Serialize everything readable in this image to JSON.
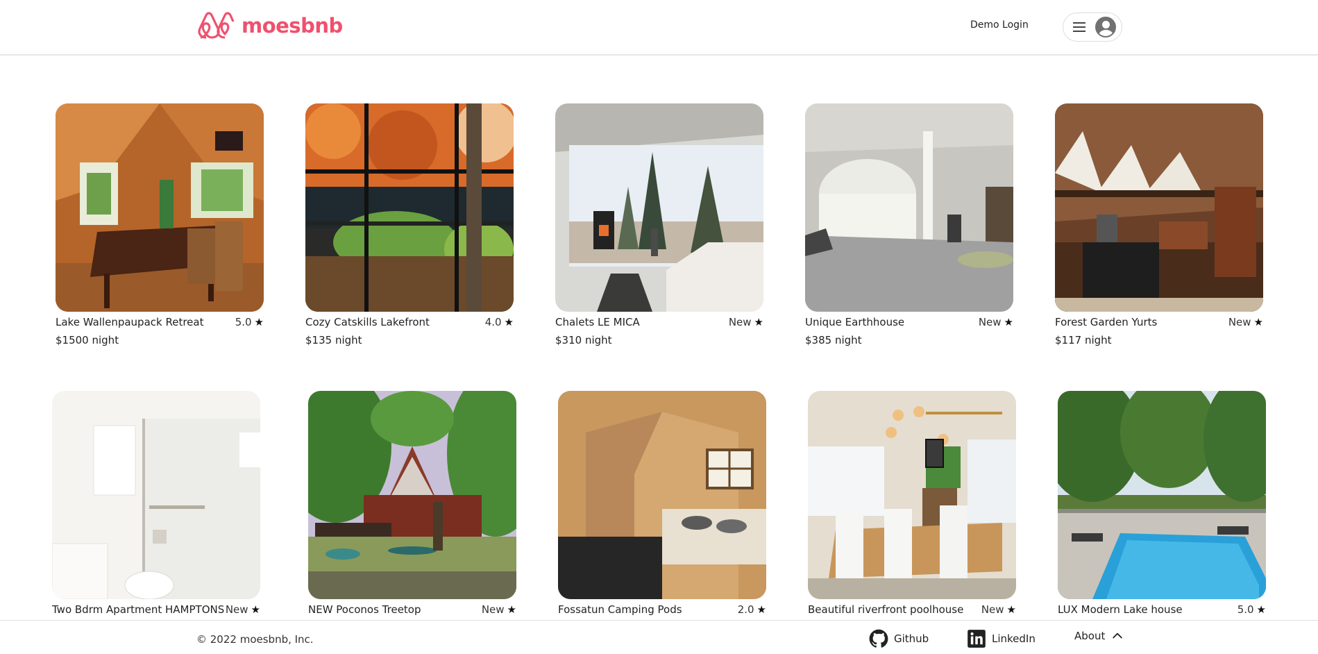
{
  "brand": {
    "name": "moesbnb",
    "color": "#f0506e"
  },
  "header": {
    "demo_login": "Demo Login",
    "menu_icon": "hamburger-icon",
    "avatar_icon": "user-avatar-icon"
  },
  "listings": [
    {
      "title": "Lake Wallenpaupack Retreat",
      "rating": "5.0",
      "price": "$1500 night"
    },
    {
      "title": "Cozy Catskills Lakefront",
      "rating": "4.0",
      "price": "$135 night"
    },
    {
      "title": "Chalets LE MICA",
      "rating": "New",
      "price": "$310 night"
    },
    {
      "title": "Unique Earthhouse",
      "rating": "New",
      "price": "$385 night"
    },
    {
      "title": "Forest Garden Yurts",
      "rating": "New",
      "price": "$117 night"
    },
    {
      "title": "Two Bdrm Apartment HAMPTONS",
      "rating": "New",
      "price": ""
    },
    {
      "title": "NEW Poconos Treetop",
      "rating": "New",
      "price": ""
    },
    {
      "title": "Fossatun Camping Pods",
      "rating": "2.0",
      "price": ""
    },
    {
      "title": "Beautiful riverfront poolhouse",
      "rating": "New",
      "price": ""
    },
    {
      "title": "LUX Modern Lake house",
      "rating": "5.0",
      "price": ""
    }
  ],
  "footer": {
    "copyright": "© 2022 moesbnb, Inc.",
    "github": "Github",
    "linkedin": "LinkedIn",
    "about": "About"
  }
}
